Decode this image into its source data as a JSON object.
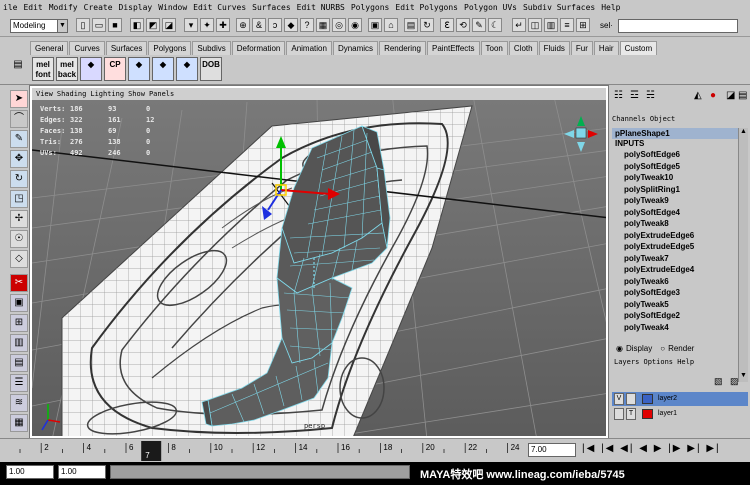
{
  "menubar": [
    "ile",
    "Edit",
    "Modify",
    "Create",
    "Display",
    "Window",
    "Edit Curves",
    "Surfaces",
    "Edit NURBS",
    "Polygons",
    "Edit Polygons",
    "Polygon UVs",
    "Subdiv Surfaces",
    "Help"
  ],
  "status": {
    "mode": "Modeling",
    "sel_label": "sel·"
  },
  "shelf_tabs": [
    "General",
    "Curves",
    "Surfaces",
    "Polygons",
    "Subdivs",
    "Deformation",
    "Animation",
    "Dynamics",
    "Rendering",
    "PaintEffects",
    "Toon",
    "Cloth",
    "Fluids",
    "Fur",
    "Hair",
    "Custom"
  ],
  "shelf_active": "Custom",
  "shelf_icons": [
    {
      "label": "mel\nfont",
      "color": "#e6e6e6"
    },
    {
      "label": "mel\nback",
      "color": "#e6e6e6"
    },
    {
      "label": "",
      "color": "#d9d9ff",
      "icon": "xform-icon"
    },
    {
      "label": "CP",
      "color": "#ffdede",
      "icon": "cp-icon"
    },
    {
      "label": "",
      "color": "#cfe0ff",
      "icon": "cube-icon"
    },
    {
      "label": "",
      "color": "#cfe0ff",
      "icon": "cylinder-icon"
    },
    {
      "label": "",
      "color": "#cfe0ff",
      "icon": "sphere-icon"
    },
    {
      "label": "DOB",
      "color": "#dedede",
      "icon": "dob-icon"
    }
  ],
  "viewport": {
    "menu": [
      "View",
      "Shading",
      "Lighting",
      "Show",
      "Panels"
    ],
    "hud_rows": [
      {
        "label": "Verts:",
        "a": "186",
        "b": "93",
        "c": "0"
      },
      {
        "label": "Edges:",
        "a": "322",
        "b": "161",
        "c": "12"
      },
      {
        "label": "Faces:",
        "a": "138",
        "b": "69",
        "c": "0"
      },
      {
        "label": "Tris:",
        "a": "276",
        "b": "138",
        "c": "0"
      },
      {
        "label": "UVs:",
        "a": "492",
        "b": "246",
        "c": "0"
      }
    ],
    "camera": "persp"
  },
  "channel_box": {
    "menu": "Channels  Object",
    "object": "pPlaneShape1",
    "inputs_label": "INPUTS",
    "items": [
      "polySoftEdge6",
      "polySoftEdge5",
      "polyTweak10",
      "polySplitRing1",
      "polyTweak9",
      "polySoftEdge4",
      "polyTweak8",
      "polyExtrudeEdge6",
      "polyExtrudeEdge5",
      "polyTweak7",
      "polyExtrudeEdge4",
      "polyTweak6",
      "polySoftEdge3",
      "polyTweak5",
      "polySoftEdge2",
      "polyTweak4"
    ]
  },
  "layer_editor": {
    "display_label": "Display",
    "render_label": "Render",
    "menu": "Layers  Options  Help",
    "layers": [
      {
        "v": "V",
        "t": "",
        "name": "layer2",
        "color": "#3a62c4",
        "selected": true
      },
      {
        "v": "",
        "t": "T",
        "name": "layer1",
        "color": "#e00000",
        "selected": false
      }
    ]
  },
  "timeline": {
    "ticks": [
      "2",
      "4",
      "6",
      "8",
      "10",
      "12",
      "14",
      "16",
      "18",
      "20",
      "22",
      "24"
    ],
    "current_frame": "7",
    "current_time": "7.00"
  },
  "range": {
    "start_time": "1.00",
    "playback_start": "1.00",
    "watermark": "MAYA特效吧  www.lineag.com/ieba/5745"
  }
}
